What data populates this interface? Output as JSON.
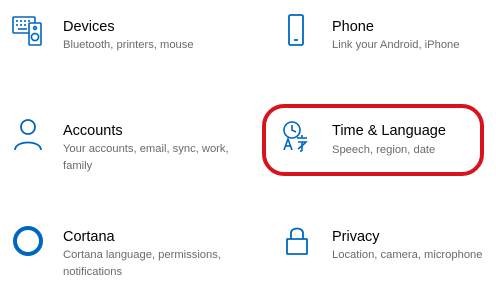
{
  "accent_color": "#0067c0",
  "highlight_color": "#d7141e",
  "tiles": {
    "devices": {
      "icon": "keyboard-speaker-icon",
      "title": "Devices",
      "desc": "Bluetooth, printers, mouse"
    },
    "phone": {
      "icon": "phone-icon",
      "title": "Phone",
      "desc": "Link your Android, iPhone"
    },
    "accounts": {
      "icon": "person-icon",
      "title": "Accounts",
      "desc": "Your accounts, email, sync, work, family"
    },
    "time_language": {
      "icon": "time-language-icon",
      "title": "Time & Language",
      "desc": "Speech, region, date"
    },
    "cortana": {
      "icon": "cortana-ring-icon",
      "title": "Cortana",
      "desc": "Cortana language, permissions, notifications"
    },
    "privacy": {
      "icon": "lock-icon",
      "title": "Privacy",
      "desc": "Location, camera, microphone"
    }
  }
}
